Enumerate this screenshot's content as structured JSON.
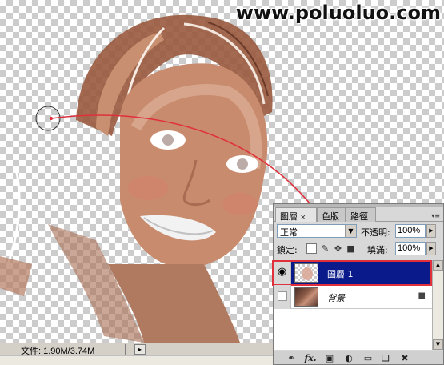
{
  "watermark": "www.poluoluo.com",
  "status": {
    "doc_size": "文件: 1.90M/3.74M",
    "arrow": "▸"
  },
  "layers_panel": {
    "tabs": [
      {
        "label": "圖層",
        "close": "×"
      },
      {
        "label": "色版"
      },
      {
        "label": "路徑"
      }
    ],
    "menu_icon": "▾≡",
    "blend_mode": "正常",
    "opacity_label": "不透明:",
    "opacity_value": "100%",
    "lock_label": "鎖定:",
    "fill_label": "填滿:",
    "fill_value": "100%",
    "layers": [
      {
        "name": "圖層 1",
        "visible": true,
        "selected": true
      },
      {
        "name": "背景",
        "visible": false,
        "locked": true
      }
    ],
    "icons": {
      "eye": "👁",
      "lock": "🔒",
      "link": "⛓",
      "fx": "fx.",
      "mask": "◙",
      "adjust": "◐",
      "group": "▭",
      "new": "❏",
      "delete": "🗑"
    }
  },
  "colors": {
    "selection": "#0a1a8a",
    "highlight": "#e0303c",
    "skin": "#c98b6e"
  }
}
